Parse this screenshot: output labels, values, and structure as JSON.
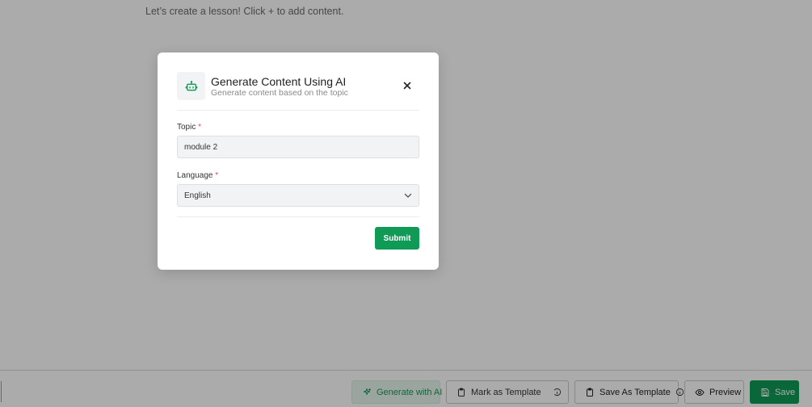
{
  "page": {
    "hint": "Let’s create a lesson! Click + to add content."
  },
  "footer": {
    "generate_label": "Generate with AI",
    "mark_template_label": "Mark as Template",
    "mark_template_toggle": false,
    "save_as_template_label": "Save As Template",
    "preview_label": "Preview",
    "save_label": "Save"
  },
  "modal": {
    "title": "Generate Content Using AI",
    "subtitle": "Generate content based on the topic",
    "topic": {
      "label": "Topic",
      "required": "*",
      "value": "module 2"
    },
    "language": {
      "label": "Language",
      "required": "*",
      "value": "English"
    },
    "submit_label": "Submit",
    "icons": [
      "robot-icon",
      "close-icon",
      "chevron-down-icon"
    ]
  },
  "colors": {
    "accent": "#0f9a55",
    "accent_light": "#e8f6ed",
    "required": "#e05050"
  }
}
